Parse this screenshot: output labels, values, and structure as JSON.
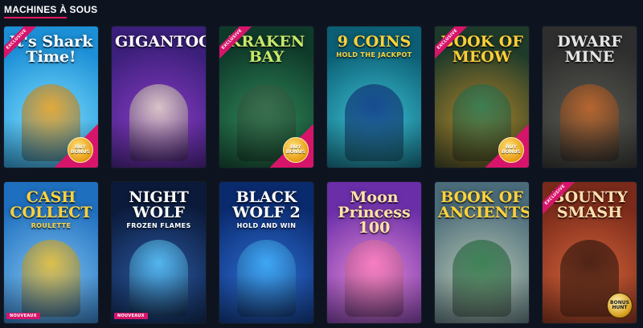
{
  "section": {
    "title": "MACHINES À SOUS"
  },
  "games": [
    {
      "logo_main": "It's Shark Time!",
      "logo_sub": "",
      "ribbon": "EXCLUSIVE",
      "badge": "BUY BONUS",
      "new_label": "",
      "theme": {
        "bg": "#1c8fd6",
        "bg2": "#7de0ff",
        "logo": "#ffffff",
        "accent": "#f7a21b"
      }
    },
    {
      "logo_main": "GIGANTOONZ",
      "logo_sub": "",
      "ribbon": "",
      "badge": "",
      "new_label": "",
      "theme": {
        "bg": "#3b1f7a",
        "bg2": "#8a3cc7",
        "logo": "#ffffff",
        "accent": "#e9dccb"
      }
    },
    {
      "logo_main": "KRAKEN BAY",
      "logo_sub": "",
      "ribbon": "EXCLUSIVE",
      "badge": "BUY BONUS",
      "new_label": "",
      "theme": {
        "bg": "#0f3a2a",
        "bg2": "#2f8a5a",
        "logo": "#c9e86b",
        "accent": "#3c6b4c"
      }
    },
    {
      "logo_main": "9 COINS",
      "logo_sub": "HOLD THE JACKPOT",
      "ribbon": "",
      "badge": "",
      "new_label": "",
      "theme": {
        "bg": "#0b5e74",
        "bg2": "#3ec4d6",
        "logo": "#ffd23a",
        "accent": "#123a8a"
      }
    },
    {
      "logo_main": "BOOK OF MEOW",
      "logo_sub": "",
      "ribbon": "EXCLUSIVE",
      "badge": "BUY BONUS",
      "new_label": "",
      "theme": {
        "bg": "#1e3a2a",
        "bg2": "#b3862a",
        "logo": "#ffcf3a",
        "accent": "#2f7f5a"
      }
    },
    {
      "logo_main": "DWARF MINE",
      "logo_sub": "",
      "ribbon": "",
      "badge": "",
      "new_label": "",
      "theme": {
        "bg": "#2e2e2e",
        "bg2": "#5a5a52",
        "logo": "#e6e6e6",
        "accent": "#c7692a"
      }
    },
    {
      "logo_main": "CASH COLLECT",
      "logo_sub": "ROULETTE",
      "ribbon": "",
      "badge": "",
      "new_label": "NOUVEAUX",
      "theme": {
        "bg": "#1f6fbf",
        "bg2": "#7fc2f0",
        "logo": "#ffd23a",
        "accent": "#f1c233"
      }
    },
    {
      "logo_main": "NIGHT WOLF",
      "logo_sub": "FROZEN FLAMES",
      "ribbon": "",
      "badge": "",
      "new_label": "NOUVEAUX",
      "theme": {
        "bg": "#0b1a3a",
        "bg2": "#2a5aa5",
        "logo": "#ffffff",
        "accent": "#5cc8ff"
      }
    },
    {
      "logo_main": "BLACK WOLF 2",
      "logo_sub": "HOLD AND WIN",
      "ribbon": "",
      "badge": "",
      "new_label": "",
      "theme": {
        "bg": "#0a2a6e",
        "bg2": "#2e6fd6",
        "logo": "#ffffff",
        "accent": "#43b3ff"
      }
    },
    {
      "logo_main": "Moon Princess 100",
      "logo_sub": "",
      "ribbon": "",
      "badge": "",
      "new_label": "",
      "theme": {
        "bg": "#6a2ea8",
        "bg2": "#e58ad6",
        "logo": "#ffe3a6",
        "accent": "#ff7fbf"
      }
    },
    {
      "logo_main": "BOOK OF ANCIENTS",
      "logo_sub": "",
      "ribbon": "",
      "badge": "",
      "new_label": "",
      "theme": {
        "bg": "#4a6b7a",
        "bg2": "#b8c7b2",
        "logo": "#ffd23a",
        "accent": "#2d7a4a"
      }
    },
    {
      "logo_main": "BOUNTY SMASH",
      "logo_sub": "",
      "ribbon": "EXCLUSIVE",
      "badge": "BONUS HUNT",
      "new_label": "",
      "theme": {
        "bg": "#7a2a1a",
        "bg2": "#d6643a",
        "logo": "#ffe0b0",
        "accent": "#3a1a10"
      }
    }
  ]
}
